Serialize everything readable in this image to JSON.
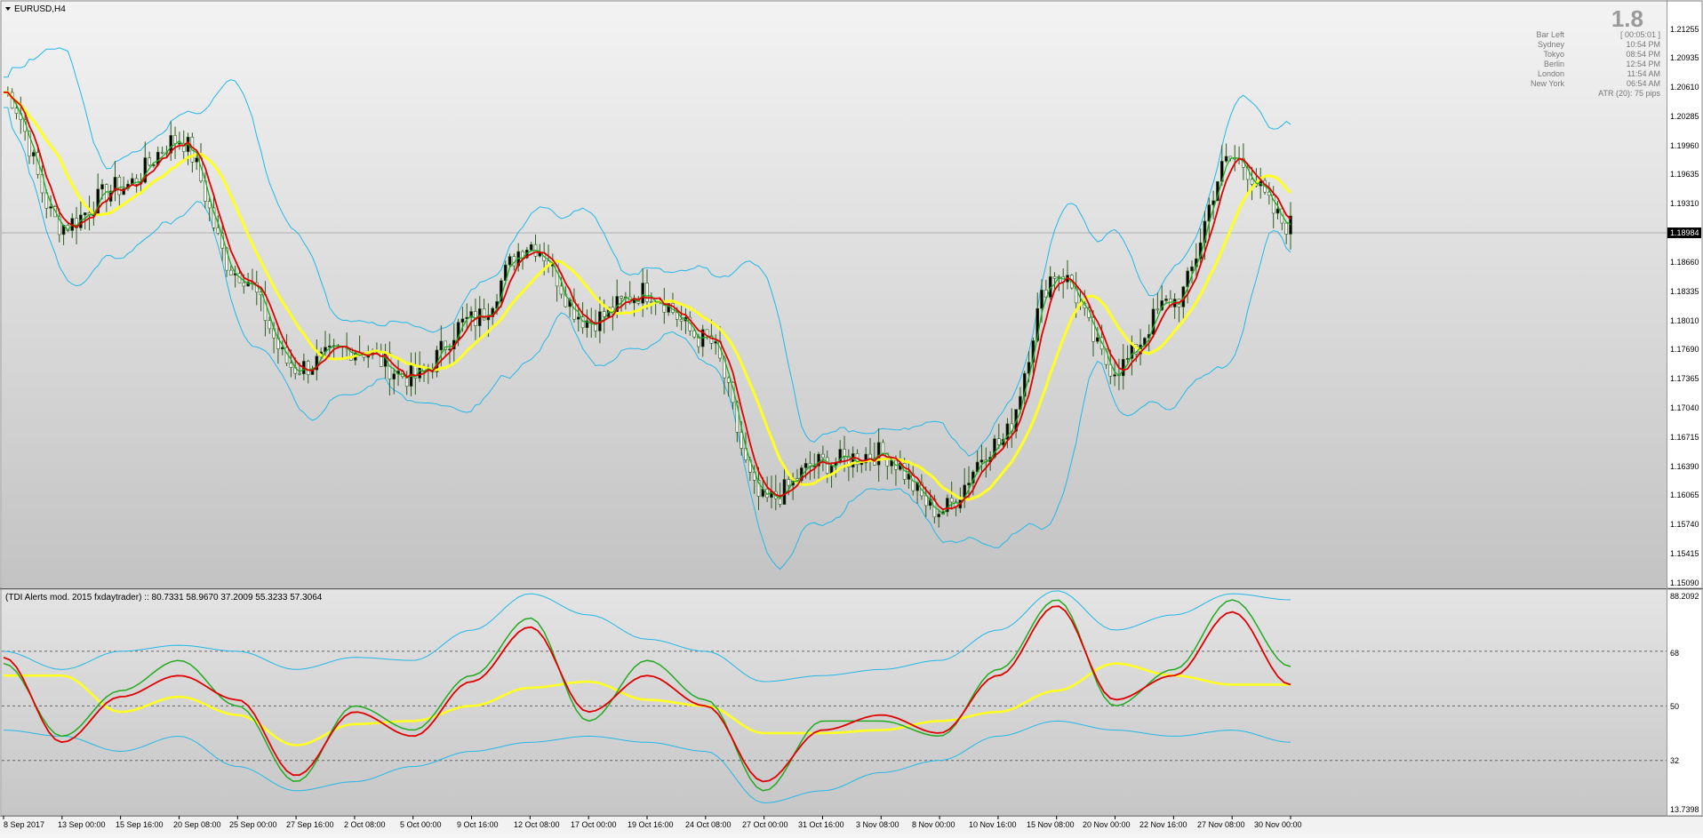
{
  "window": {
    "symbol_label": "EURUSD,H4"
  },
  "price_axis": {
    "labels": [
      "1.21255",
      "1.20935",
      "1.20610",
      "1.20285",
      "1.19960",
      "1.19635",
      "1.19310",
      "1.18660",
      "1.18335",
      "1.18010",
      "1.17690",
      "1.17365",
      "1.17040",
      "1.16715",
      "1.16390",
      "1.16065",
      "1.15740",
      "1.15415",
      "1.15090"
    ],
    "current_price": "1.18984"
  },
  "info_panel": {
    "big_value": "1.8",
    "rows": [
      {
        "label": "Bar Left",
        "value": "[ 00:05:01 ]"
      },
      {
        "label": "Sydney",
        "value": "10:54 PM"
      },
      {
        "label": "Tokyo",
        "value": "08:54 PM"
      },
      {
        "label": "Berlin",
        "value": "12:54 PM"
      },
      {
        "label": "London",
        "value": "11:54 AM"
      },
      {
        "label": "New York",
        "value": "06:54 AM"
      }
    ],
    "atr": "ATR (20): 75 pips"
  },
  "indicator": {
    "header": "(TDI Alerts mod. 2015 fxdaytrader) ::  80.7331 58.9670 37.2009 55.3233 57.3064",
    "axis_labels": [
      "88.2092",
      "68",
      "50",
      "32",
      "13.7398"
    ]
  },
  "time_axis": {
    "labels": [
      "8 Sep 2017",
      "13 Sep 00:00",
      "15 Sep 16:00",
      "20 Sep 08:00",
      "25 Sep 00:00",
      "27 Sep 16:00",
      "2 Oct 08:00",
      "5 Oct 00:00",
      "9 Oct 16:00",
      "12 Oct 08:00",
      "17 Oct 00:00",
      "19 Oct 16:00",
      "24 Oct 08:00",
      "27 Oct 00:00",
      "31 Oct 16:00",
      "3 Nov 08:00",
      "8 Nov 00:00",
      "10 Nov 16:00",
      "15 Nov 08:00",
      "20 Nov 00:00",
      "22 Nov 16:00",
      "27 Nov 08:00",
      "30 Nov 00:00"
    ]
  },
  "colors": {
    "candle": "#2f5c1e",
    "fast_ma": "#e00000",
    "slow_ma": "#ffff22",
    "bands": "#22b8e8",
    "rsi_price": "#22aa22",
    "axis_text": "#000000"
  },
  "chart_data": [
    {
      "type": "candlestick",
      "symbol": "EURUSD",
      "timeframe": "H4",
      "ylim": [
        1.1509,
        1.2125
      ],
      "current_price": 1.18984,
      "close_path": {
        "x": [
          "8 Sep 2017",
          "13 Sep 00:00",
          "15 Sep 16:00",
          "20 Sep 08:00",
          "25 Sep 00:00",
          "27 Sep 16:00",
          "2 Oct 08:00",
          "5 Oct 00:00",
          "9 Oct 16:00",
          "12 Oct 08:00",
          "17 Oct 00:00",
          "19 Oct 16:00",
          "24 Oct 08:00",
          "27 Oct 00:00",
          "31 Oct 16:00",
          "3 Nov 08:00",
          "8 Nov 00:00",
          "10 Nov 16:00",
          "15 Nov 08:00",
          "20 Nov 00:00",
          "22 Nov 16:00",
          "27 Nov 08:00",
          "30 Nov 00:00"
        ],
        "values": [
          1.203,
          1.189,
          1.193,
          1.198,
          1.184,
          1.174,
          1.176,
          1.173,
          1.179,
          1.187,
          1.179,
          1.182,
          1.177,
          1.16,
          1.164,
          1.165,
          1.159,
          1.166,
          1.184,
          1.174,
          1.181,
          1.196,
          1.189
        ]
      },
      "series": [
        {
          "name": "fast MA",
          "color": "#e00000"
        },
        {
          "name": "slow MA",
          "color": "#ffff22"
        },
        {
          "name": "Bollinger bands",
          "color": "#22b8e8"
        }
      ]
    },
    {
      "type": "line",
      "title": "(TDI Alerts mod. 2015 fxdaytrader) ::  80.7331 58.9670 37.2009 55.3233 57.3064",
      "ylim": [
        13.7398,
        88.2092
      ],
      "levels": [
        68,
        50,
        32
      ],
      "x": [
        "8 Sep 2017",
        "13 Sep 00:00",
        "15 Sep 16:00",
        "20 Sep 08:00",
        "25 Sep 00:00",
        "27 Sep 16:00",
        "2 Oct 08:00",
        "5 Oct 00:00",
        "9 Oct 16:00",
        "12 Oct 08:00",
        "17 Oct 00:00",
        "19 Oct 16:00",
        "24 Oct 08:00",
        "27 Oct 00:00",
        "31 Oct 16:00",
        "3 Nov 08:00",
        "8 Nov 00:00",
        "10 Nov 16:00",
        "15 Nov 08:00",
        "20 Nov 00:00",
        "22 Nov 16:00",
        "27 Nov 08:00",
        "30 Nov 00:00"
      ],
      "series": [
        {
          "color": "#22aa22",
          "values": [
            64,
            40,
            55,
            65,
            50,
            25,
            50,
            42,
            60,
            79,
            45,
            65,
            52,
            22,
            45,
            45,
            40,
            62,
            85,
            50,
            62,
            85,
            63
          ]
        },
        {
          "color": "#e00000",
          "values": [
            66,
            38,
            53,
            60,
            52,
            27,
            48,
            40,
            58,
            76,
            48,
            60,
            50,
            25,
            42,
            47,
            41,
            60,
            83,
            52,
            60,
            81,
            57
          ]
        },
        {
          "color": "#ffff22",
          "values": [
            60,
            60,
            48,
            53,
            47,
            37,
            44,
            45,
            50,
            56,
            58,
            52,
            50,
            41,
            41,
            42,
            45,
            48,
            55,
            64,
            60,
            57,
            57
          ]
        },
        {
          "color": "#22b8e8",
          "values": [
            68,
            62,
            68,
            70,
            68,
            62,
            66,
            65,
            75,
            87,
            80,
            72,
            68,
            58,
            60,
            62,
            65,
            75,
            88,
            75,
            80,
            87,
            85
          ]
        },
        {
          "color": "#22b8e8",
          "values": [
            42,
            40,
            35,
            40,
            30,
            22,
            25,
            30,
            35,
            38,
            40,
            38,
            35,
            18,
            22,
            28,
            32,
            40,
            45,
            42,
            40,
            42,
            38
          ]
        }
      ]
    }
  ]
}
